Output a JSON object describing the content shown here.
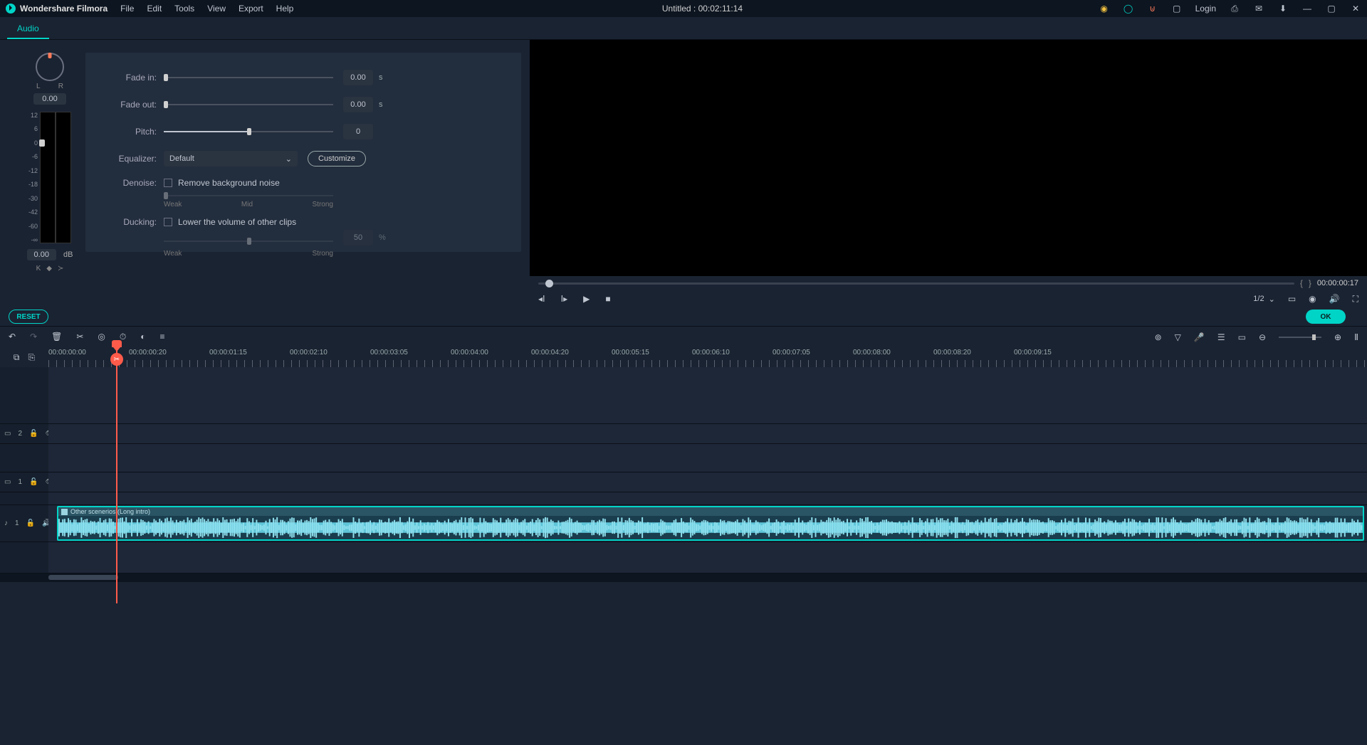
{
  "app_name": "Wondershare Filmora",
  "menu": [
    "File",
    "Edit",
    "Tools",
    "View",
    "Export",
    "Help"
  ],
  "title": "Untitled : 00:02:11:14",
  "login": "Login",
  "tab_audio": "Audio",
  "pan": {
    "L": "L",
    "R": "R",
    "value": "0.00"
  },
  "meter": {
    "labels": [
      "12",
      "6",
      "0",
      "-6",
      "-12",
      "-18",
      "-30",
      "-42",
      "-60",
      "-∞"
    ],
    "db_value": "0.00",
    "db_unit": "dB"
  },
  "controls": {
    "fade_in_label": "Fade in:",
    "fade_in_value": "0.00",
    "fade_in_unit": "s",
    "fade_out_label": "Fade out:",
    "fade_out_value": "0.00",
    "fade_out_unit": "s",
    "pitch_label": "Pitch:",
    "pitch_value": "0",
    "equalizer_label": "Equalizer:",
    "equalizer_value": "Default",
    "customize": "Customize",
    "denoise_label": "Denoise:",
    "denoise_text": "Remove background noise",
    "denoise_scale": [
      "Weak",
      "Mid",
      "Strong"
    ],
    "ducking_label": "Ducking:",
    "ducking_text": "Lower the volume of other clips",
    "ducking_value": "50",
    "ducking_unit": "%",
    "ducking_scale": [
      "Weak",
      "Strong"
    ]
  },
  "reset": "RESET",
  "ok": "OK",
  "preview": {
    "timecode": "00:00:00:17",
    "zoom": "1/2"
  },
  "timeline": {
    "ruler": [
      "00:00:00:00",
      "00:00:00:20",
      "00:00:01:15",
      "00:00:02:10",
      "00:00:03:05",
      "00:00:04:00",
      "00:00:04:20",
      "00:00:05:15",
      "00:00:06:10",
      "00:00:07:05",
      "00:00:08:00",
      "00:00:08:20",
      "00:00:09:15"
    ],
    "tracks": {
      "v2": "2",
      "v1": "1",
      "a1": "1"
    },
    "clip_name": "Other scenerios  (Long intro)"
  }
}
